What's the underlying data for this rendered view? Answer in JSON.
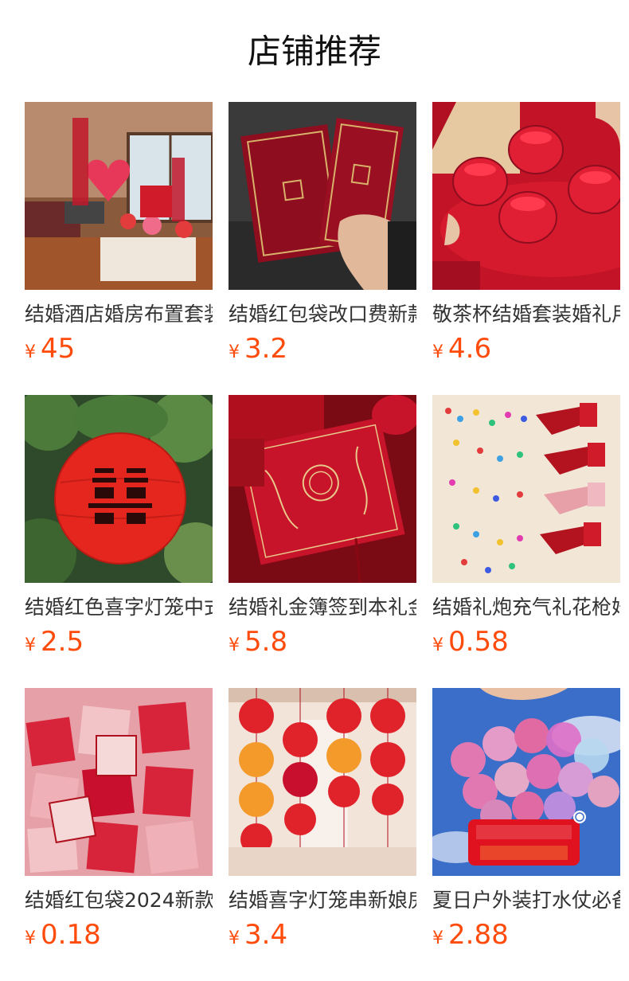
{
  "section": {
    "title": "店铺推荐"
  },
  "currency_symbol": "¥",
  "products": [
    {
      "name": "结婚酒店婚房布置套装",
      "price": "45",
      "image": "wedding-room-decoration"
    },
    {
      "name": "结婚红包袋改口费新款",
      "price": "3.2",
      "image": "red-envelopes"
    },
    {
      "name": "敬茶杯结婚套装婚礼用品",
      "price": "4.6",
      "image": "red-tea-cups"
    },
    {
      "name": "结婚红色喜字灯笼中式",
      "price": "2.5",
      "image": "red-lantern"
    },
    {
      "name": "结婚礼金簿签到本礼金",
      "price": "5.8",
      "image": "gift-money-book"
    },
    {
      "name": "结婚礼炮充气礼花枪婚庆",
      "price": "0.58",
      "image": "confetti-cannons"
    },
    {
      "name": "结婚红包袋2024新款",
      "price": "0.18",
      "image": "red-packets"
    },
    {
      "name": "结婚喜字灯笼串新娘房",
      "price": "3.4",
      "image": "lantern-strings"
    },
    {
      "name": "夏日户外装打水仗必备",
      "price": "2.88",
      "image": "water-balloons"
    }
  ],
  "colors": {
    "price": "#ff4c0c",
    "title": "#111111",
    "name": "#333333",
    "wedding_red": "#c8102e"
  }
}
